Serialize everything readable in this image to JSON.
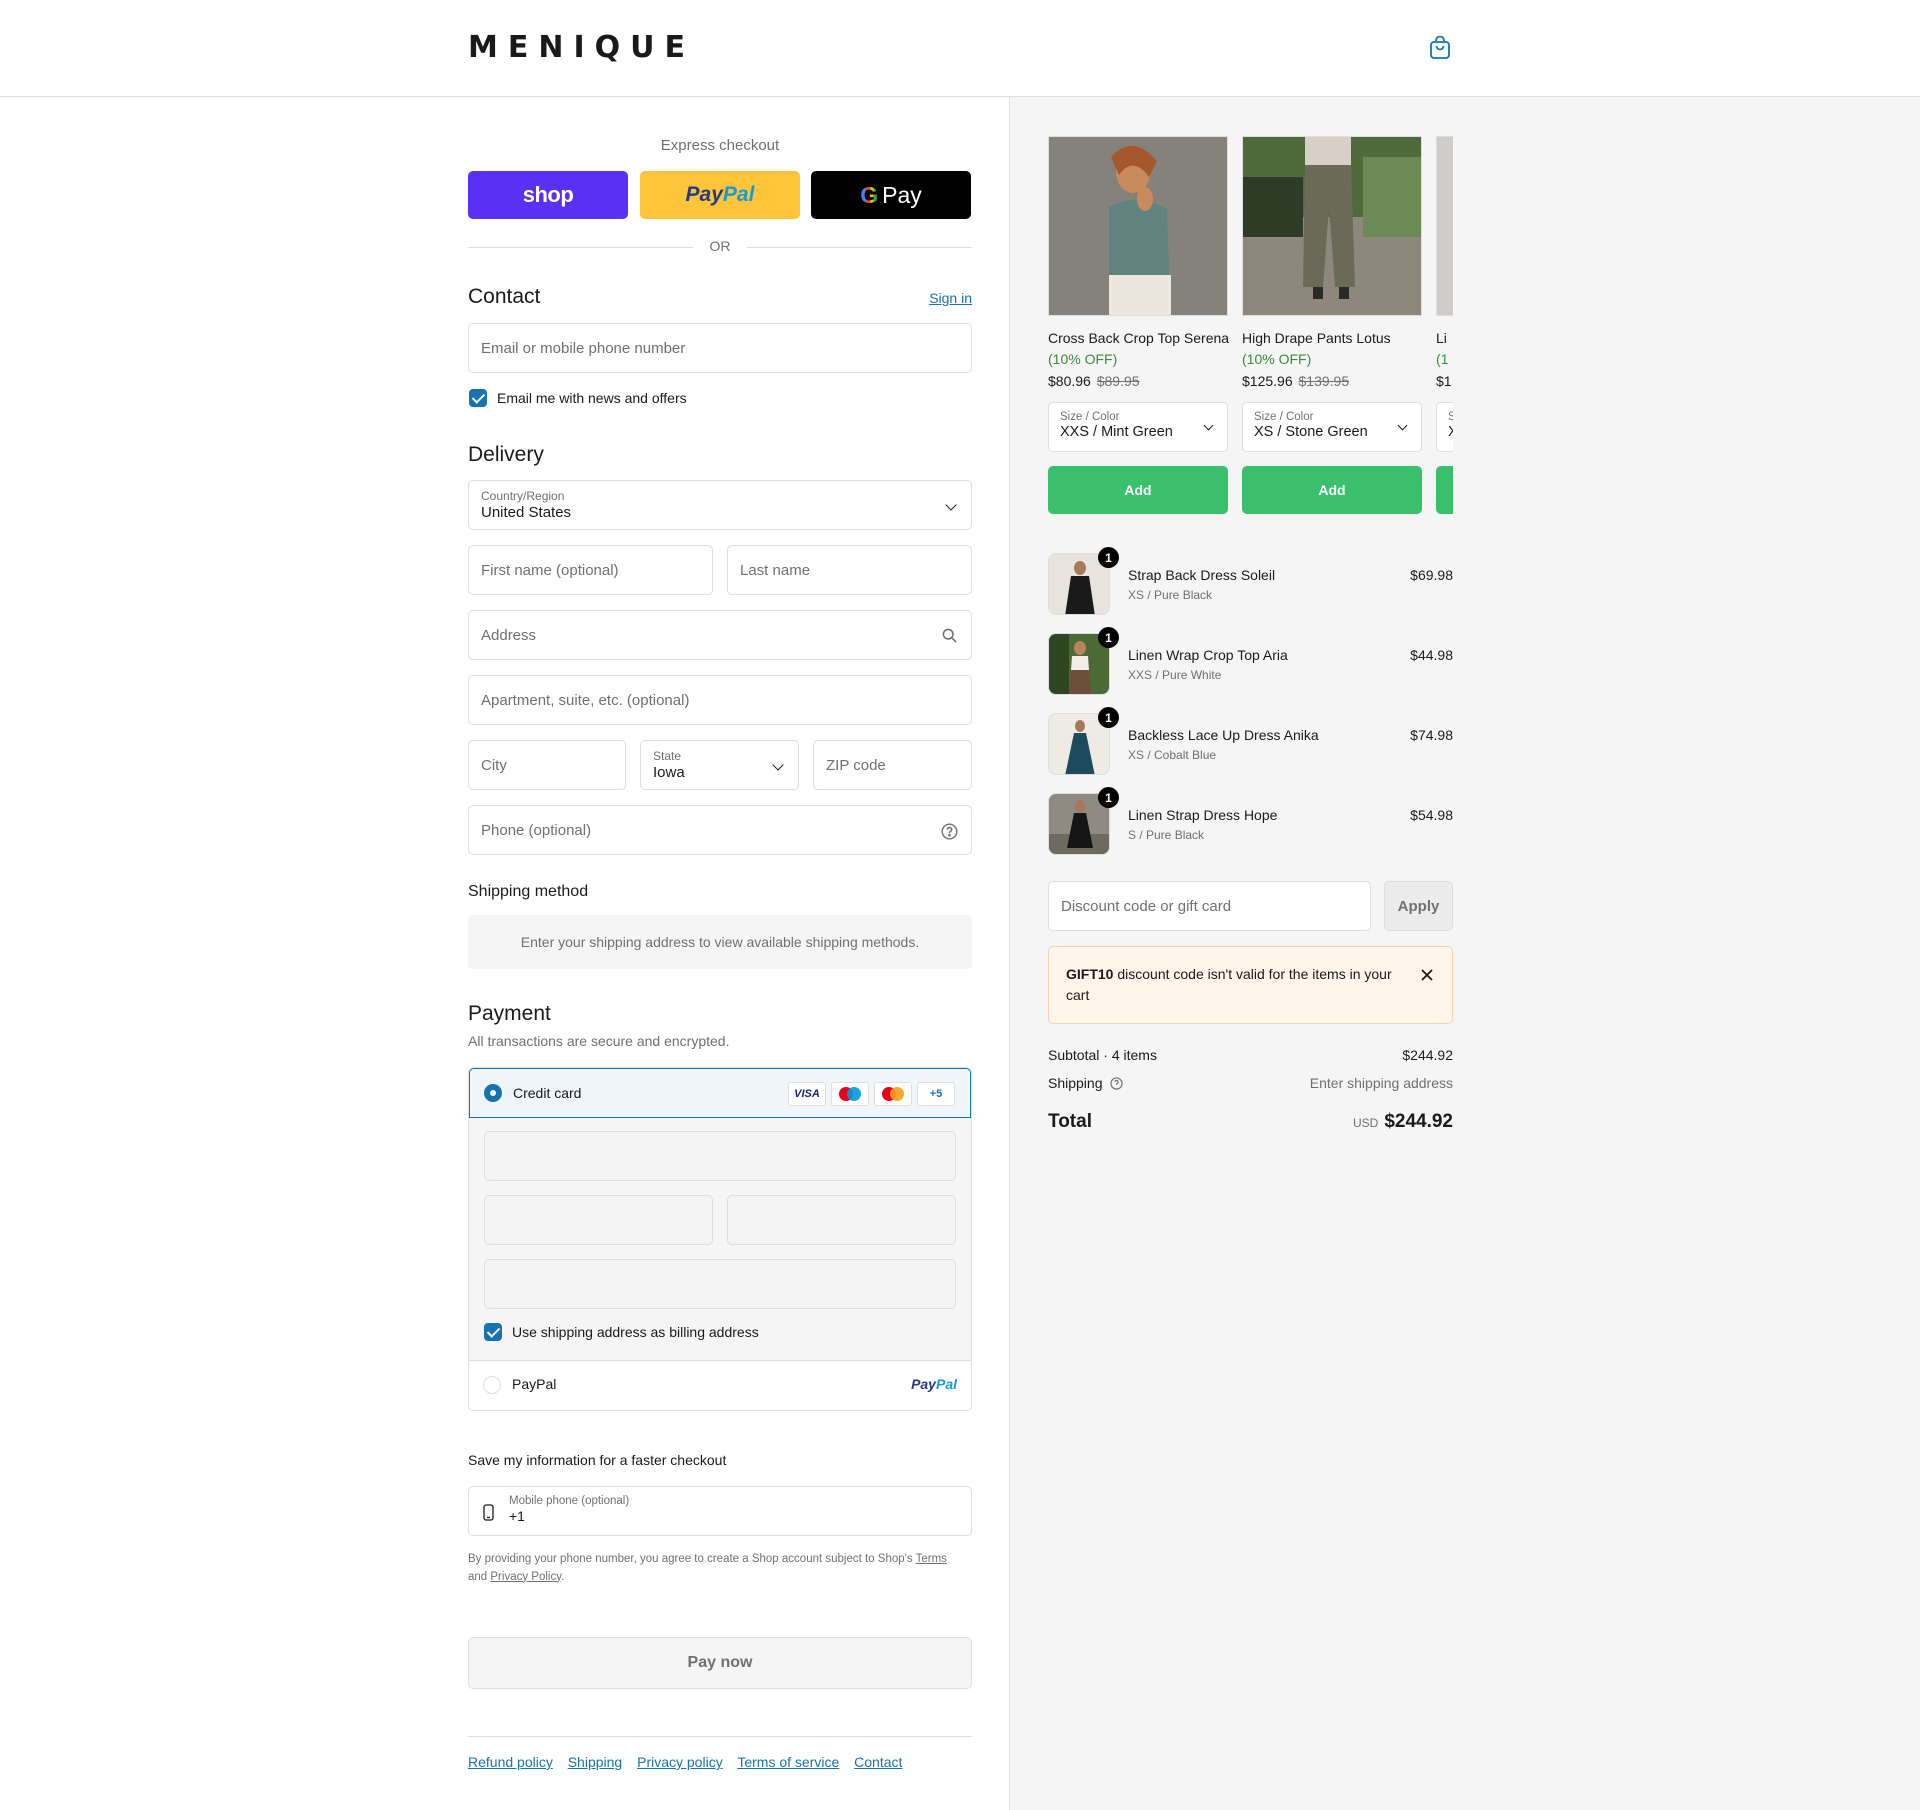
{
  "header": {
    "logo": "MENIQUE"
  },
  "express": {
    "title": "Express checkout",
    "shop_label": "shop",
    "paypal_label_1": "Pay",
    "paypal_label_2": "Pal",
    "gpay_label": "Pay",
    "or": "OR"
  },
  "contact": {
    "heading": "Contact",
    "sign_in": "Sign in",
    "email_placeholder": "Email or mobile phone number",
    "news_label": "Email me with news and offers"
  },
  "delivery": {
    "heading": "Delivery",
    "country_label": "Country/Region",
    "country_value": "United States",
    "first_name": "First name (optional)",
    "last_name": "Last name",
    "address": "Address",
    "apartment": "Apartment, suite, etc. (optional)",
    "city": "City",
    "state_label": "State",
    "state_value": "Iowa",
    "zip": "ZIP code",
    "phone": "Phone (optional)"
  },
  "shipping_method": {
    "heading": "Shipping method",
    "message": "Enter your shipping address to view available shipping methods."
  },
  "payment": {
    "heading": "Payment",
    "subtitle": "All transactions are secure and encrypted.",
    "credit_card_label": "Credit card",
    "card_badges": [
      "VISA",
      "+5"
    ],
    "billing_label": "Use shipping address as billing address",
    "paypal_label": "PayPal",
    "paypal_logo_1": "Pay",
    "paypal_logo_2": "Pal"
  },
  "save_info": {
    "heading": "Save my information for a faster checkout",
    "phone_label": "Mobile phone (optional)",
    "phone_value": "+1",
    "disclaimer_1": "By providing your phone number, you agree to create a Shop account subject to Shop's ",
    "terms": "Terms",
    "disclaimer_2": "and ",
    "privacy": "Privacy Policy",
    "disclaimer_3": "."
  },
  "pay_now": "Pay now",
  "footer": [
    "Refund policy",
    "Shipping",
    "Privacy policy",
    "Terms of service",
    "Contact"
  ],
  "upsell": [
    {
      "name": "Cross Back Crop Top Serena",
      "off": "(10% OFF)",
      "price": "$80.96",
      "old_price": "$89.95",
      "select_label": "Size / Color",
      "select_value": "XXS / Mint Green",
      "add": "Add"
    },
    {
      "name": "High Drape Pants Lotus",
      "off": "(10% OFF)",
      "price": "$125.96",
      "old_price": "$139.95",
      "select_label": "Size / Color",
      "select_value": "XS / Stone Green",
      "add": "Add"
    },
    {
      "name": "Li",
      "off": "(1",
      "price": "$1",
      "old_price": "",
      "select_label": "S",
      "select_value": "X",
      "add": ""
    }
  ],
  "cart": [
    {
      "qty": "1",
      "name": "Strap Back Dress Soleil",
      "variant": "XS / Pure Black",
      "price": "$69.98"
    },
    {
      "qty": "1",
      "name": "Linen Wrap Crop Top Aria",
      "variant": "XXS / Pure White",
      "price": "$44.98"
    },
    {
      "qty": "1",
      "name": "Backless Lace Up Dress Anika",
      "variant": "XS / Cobalt Blue",
      "price": "$74.98"
    },
    {
      "qty": "1",
      "name": "Linen Strap Dress Hope",
      "variant": "S / Pure Black",
      "price": "$54.98"
    }
  ],
  "discount": {
    "placeholder": "Discount code or gift card",
    "apply": "Apply",
    "notice_code": "GIFT10",
    "notice_text": " discount code isn't valid for the items in your cart"
  },
  "summary": {
    "subtotal_label": "Subtotal · 4 items",
    "subtotal_value": "$244.92",
    "shipping_label": "Shipping",
    "shipping_value": "Enter shipping address",
    "total_label": "Total",
    "currency": "USD",
    "total_value": "$244.92"
  },
  "colors": {
    "accent": "#1773b0",
    "shop": "#5a31f4",
    "paypal": "#ffc439",
    "add_button": "#3ac06d"
  }
}
